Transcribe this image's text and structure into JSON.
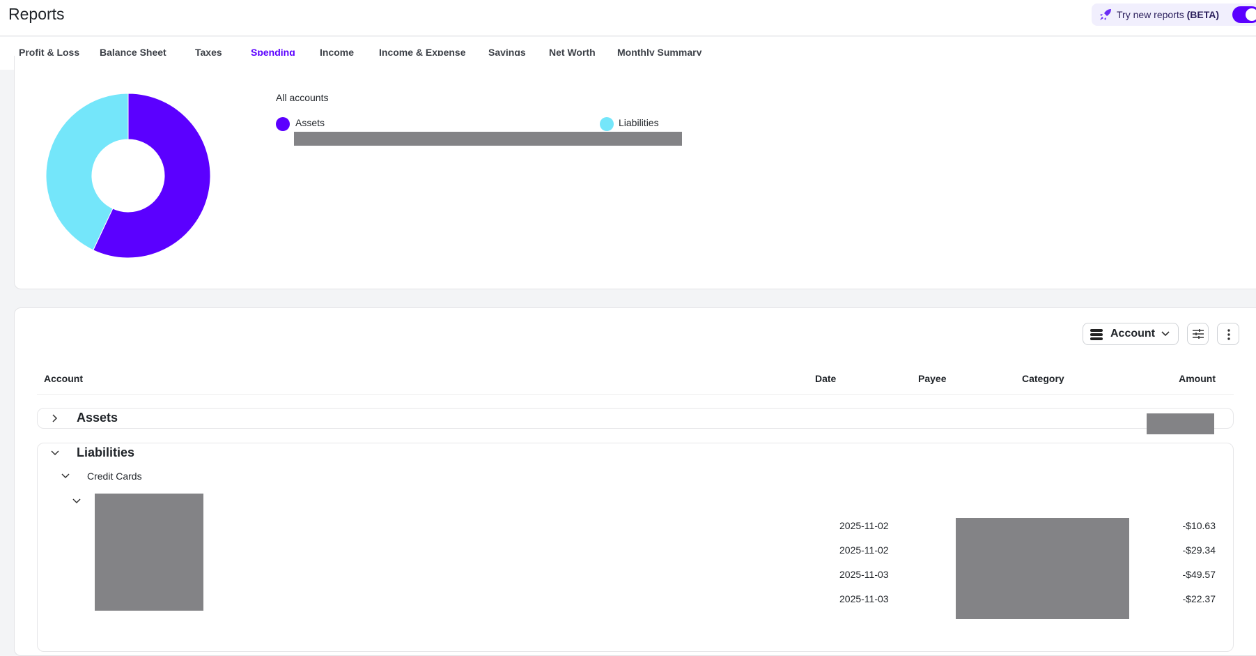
{
  "header": {
    "title": "Reports",
    "beta_text": "Try new reports",
    "beta_badge": "(BETA)",
    "beta_enabled": true
  },
  "tabs": [
    {
      "label": "Profit & Loss"
    },
    {
      "label": "Balance Sheet"
    },
    {
      "label": "Taxes"
    },
    {
      "label": "Spending",
      "active": true
    },
    {
      "label": "Income"
    },
    {
      "label": "Income & Expense"
    },
    {
      "label": "Savings"
    },
    {
      "label": "Net Worth"
    },
    {
      "label": "Monthly Summary"
    }
  ],
  "chart_data": {
    "type": "pie",
    "title": "All accounts",
    "categories": [
      "Assets",
      "Liabilities"
    ],
    "values": [
      57,
      43
    ],
    "colors": [
      "#5b00ff",
      "#74e6fa"
    ],
    "legend": "right"
  },
  "toolbar": {
    "group_by_label": "Account"
  },
  "table": {
    "columns": [
      "Account",
      "Date",
      "Payee",
      "Category",
      "Amount"
    ],
    "groups": [
      {
        "label": "Assets",
        "expanded": false
      },
      {
        "label": "Liabilities",
        "expanded": true,
        "subgroup": "Credit Cards"
      }
    ],
    "rows": [
      {
        "date": "2025-11-02",
        "amount": "-$10.63"
      },
      {
        "date": "2025-11-02",
        "amount": "-$29.34"
      },
      {
        "date": "2025-11-03",
        "amount": "-$49.57"
      },
      {
        "date": "2025-11-03",
        "amount": "-$22.37"
      }
    ]
  }
}
